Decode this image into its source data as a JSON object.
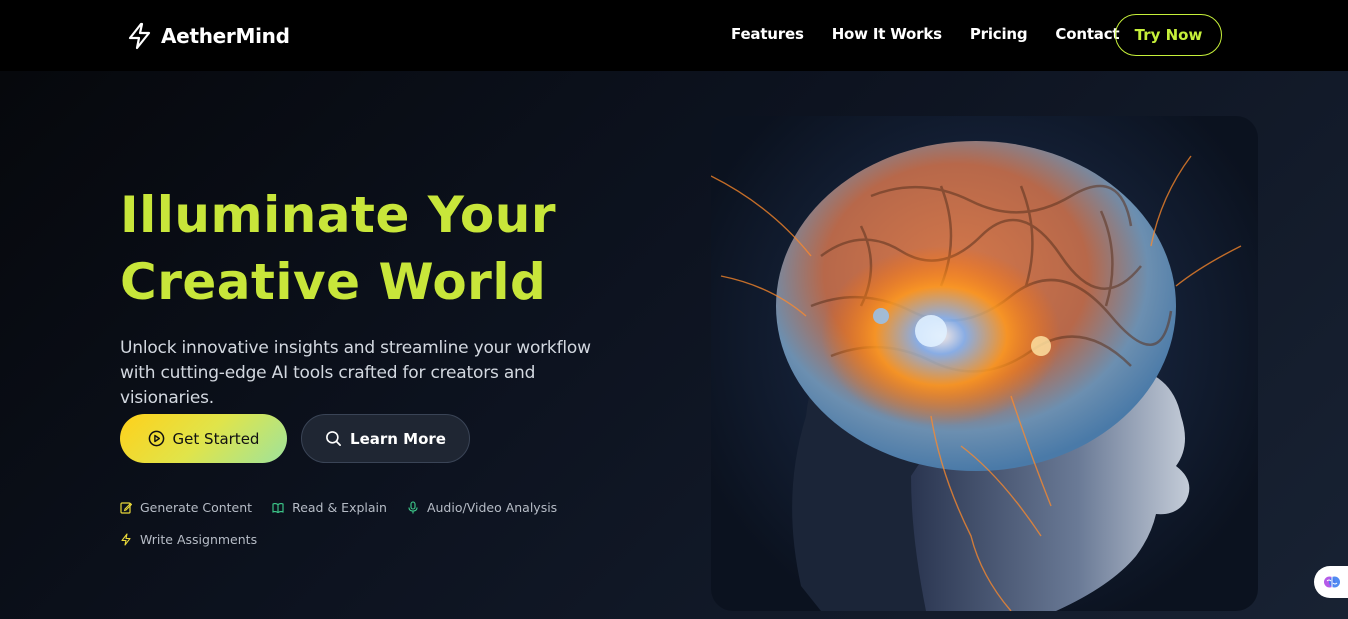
{
  "brand": {
    "name": "AetherMind",
    "logo_icon": "lightning-bolt-icon"
  },
  "nav": {
    "links": [
      "Features",
      "How It Works",
      "Pricing",
      "Contact"
    ],
    "cta": "Try Now"
  },
  "hero": {
    "title_line1": "Illuminate Your",
    "title_line2": "Creative World",
    "subtitle": "Unlock innovative insights and streamline your workflow with cutting-edge AI tools crafted for creators and visionaries.",
    "primary_button": {
      "label": "Get Started",
      "icon": "play-circle-icon"
    },
    "secondary_button": {
      "label": "Learn More",
      "icon": "search-icon"
    },
    "features": [
      {
        "label": "Generate Content",
        "icon": "edit-icon",
        "color": "#e8d83a"
      },
      {
        "label": "Read & Explain",
        "icon": "book-open-icon",
        "color": "#3fcf8e"
      },
      {
        "label": "Audio/Video Analysis",
        "icon": "microphone-icon",
        "color": "#3fcf8e"
      },
      {
        "label": "Write Assignments",
        "icon": "lightning-bolt-icon",
        "color": "#e8d83a"
      }
    ],
    "image": "glowing-brain-illustration"
  },
  "colors": {
    "accent": "#c8e63a",
    "nav_background": "#000000",
    "page_background": "#0a0d14"
  },
  "chat_widget": {
    "icon": "brain-chat-icon"
  }
}
